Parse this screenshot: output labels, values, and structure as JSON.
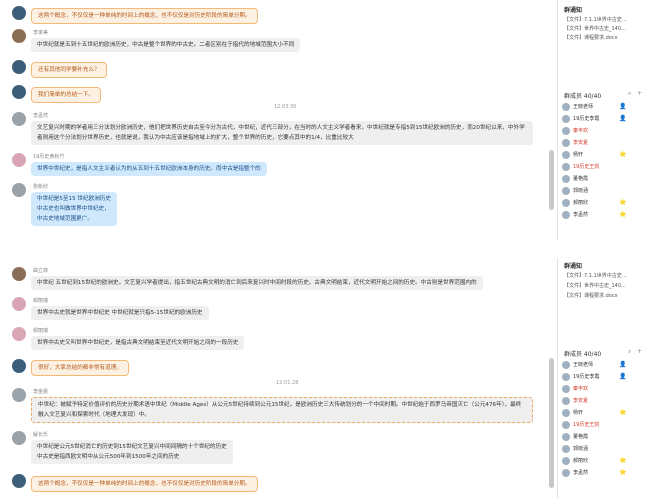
{
  "panel1": {
    "messages": [
      {
        "avatar": "dark",
        "name": "",
        "text": "这两个概念，不仅仅是一种单纯的时间上的概念，也不仅仅是对历史阶段的简单分期。",
        "style": "orange"
      },
      {
        "avatar": "brown",
        "name": "李家美",
        "text": "中世纪就是五到十五世纪的欧洲历史，中古是整个世界的中古史。二者区别在于指代的地域范围大小不同",
        "style": "plain"
      },
      {
        "avatar": "dark",
        "name": "",
        "text": "还有其他同学要补充么？",
        "style": "orange"
      },
      {
        "avatar": "dark",
        "name": "",
        "text": "我们简单的总结一下。",
        "style": "orange"
      },
      {
        "avatar": "gray",
        "name": "李孟然",
        "text": "文艺复兴时期的学者用三分法划分欧洲历史，他们把世界历史自古至今分为古代，中世纪，近代三部分，在当时的人文主义学者看来，中世纪就是专指5到15世纪欧洲的历史，而20世纪以来，中外学者则用这个分法划分世界历史，也就是说，我认为中古应该是指地域上的扩大，整个世界的历史，它要点其中的1/4，比重比较大",
        "style": "plain"
      },
      {
        "avatar": "pink",
        "name": "19历史黄秋竹",
        "text": "世界中世纪史，是指人文主义者认为的从五到十五世纪欧洲本身的历史。而中古是指整个的",
        "style": "blue"
      },
      {
        "avatar": "gray",
        "name": "詹新欣",
        "text": "中世纪是5至15 世纪欧洲历史\n中古史也叫做世界中世纪史，\n中古史地域范围更广。",
        "style": "blue"
      }
    ],
    "timestamp": "12:03:30"
  },
  "panel2": {
    "messages": [
      {
        "avatar": "brown",
        "name": "曲立菲",
        "text": "中世纪   五世纪到15世纪的欧洲史。文艺复兴学者提出，指五世纪古典文明的消亡到后来复兴时中间时段的历史。古典文明结束，近代文明开始之间的历史。中古则是世界范围内的",
        "style": "plain"
      },
      {
        "avatar": "pink",
        "name": "郝丽瑞",
        "text": "世界中古史就是世界中世纪史 中世纪就是只指5-15世纪的欧洲历史",
        "style": "plain"
      },
      {
        "avatar": "pink",
        "name": "郝丽瑞",
        "text": "世界中古史又叫世界中世纪史，是指古典文明结束至近代文明开始之间的一段历史",
        "style": "plain"
      },
      {
        "avatar": "dark",
        "name": "",
        "text": "很好，大家总结的都非常有道理。",
        "style": "orange"
      },
      {
        "avatar": "gray",
        "name": "李金晨",
        "text": "中世纪：被赋予特定价值评价的历史分期术语中世纪（Middle Ages）从公元5世纪持续到公元15世纪，是欧洲历史三大传统划分的一个中间时期。中世纪始于西罗马帝国灭亡（公元476年），最终融入文艺复兴和探索时代（地理大发现）中。",
        "style": "plain"
      },
      {
        "avatar": "gray",
        "name": "解长乐",
        "text": "中世纪是公元5世纪消亡的历史到15世纪文艺复兴中间间隔的十个世纪的历史\n中古史是指西欧文明中从公元500年到1500年之间的历史",
        "style": "plain"
      },
      {
        "avatar": "dark",
        "name": "",
        "text": "这两个概念，不仅仅是一种单纯的时间上的概念，也不仅仅是对历史阶段的简单分期。",
        "style": "orange"
      }
    ],
    "timestamp": "12:01:28"
  },
  "sidebar": {
    "notice_title": "群通知",
    "files": [
      "【文件】7.1.1世界中古史...",
      "【文件】世界中古史_140...",
      "【文件】课程要求.docx"
    ],
    "member_count": "群成员 40/40",
    "members": [
      {
        "name": "王晓老师",
        "color": "normal",
        "badge": "👤"
      },
      {
        "name": "19历史李霞",
        "color": "normal",
        "badge": "👤"
      },
      {
        "name": "秦丰欢",
        "color": "red",
        "badge": ""
      },
      {
        "name": "李安夏",
        "color": "red",
        "badge": ""
      },
      {
        "name": "杨轩",
        "color": "normal",
        "badge": "⭐"
      },
      {
        "name": "19历史王凯",
        "color": "red",
        "badge": ""
      },
      {
        "name": "董艳霞",
        "color": "normal",
        "badge": ""
      },
      {
        "name": "郭晓涵",
        "color": "normal",
        "badge": ""
      },
      {
        "name": "郝丽欣",
        "color": "normal",
        "badge": "⭐"
      },
      {
        "name": "李孟然",
        "color": "normal",
        "badge": "⭐"
      }
    ]
  }
}
